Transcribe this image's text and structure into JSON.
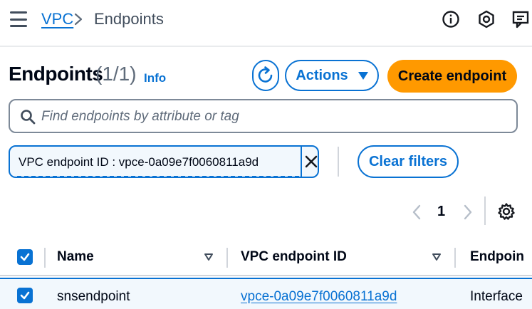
{
  "breadcrumb": {
    "parent": "VPC",
    "current": "Endpoints"
  },
  "header": {
    "title": "Endpoints",
    "count": "(1/1)",
    "info": "Info"
  },
  "toolbar": {
    "actions_label": "Actions",
    "create_label": "Create endpoint"
  },
  "search": {
    "placeholder": "Find endpoints by attribute or tag"
  },
  "filter": {
    "token": "VPC endpoint ID : vpce-0a09e7f0060811a9d",
    "clear_label": "Clear filters"
  },
  "pagination": {
    "current_page": "1"
  },
  "table": {
    "columns": [
      "Name",
      "VPC endpoint ID",
      "Endpoin"
    ],
    "rows": [
      {
        "name": "snsendpoint",
        "endpoint_id": "vpce-0a09e7f0060811a9d",
        "endpoint_type": "Interface"
      }
    ]
  },
  "colors": {
    "accent": "#0972d3",
    "primary_button": "#ff9900",
    "text": "#000716",
    "muted": "#5f6b7a"
  },
  "icons": [
    "menu-icon",
    "chevron-right-icon",
    "info-icon",
    "notifications-icon",
    "feedback-icon",
    "refresh-icon",
    "caret-down-icon",
    "search-icon",
    "close-icon",
    "chevron-left-icon",
    "chevron-right-icon",
    "gear-icon",
    "checkbox-checked-icon",
    "sort-icon"
  ]
}
